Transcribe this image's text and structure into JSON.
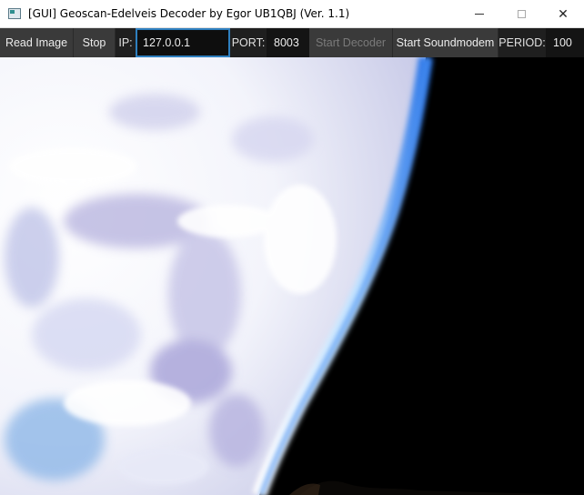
{
  "window": {
    "title": "[GUI] Geoscan-Edelveis Decoder by Egor UB1QBJ (Ver. 1.1)",
    "controls": {
      "close_glyph": "✕"
    }
  },
  "toolbar": {
    "read_image_label": "Read Image",
    "stop_label": "Stop",
    "ip_label": "IP:",
    "ip_value": "127.0.0.1",
    "port_label": "PORT:",
    "port_value": "8003",
    "start_decoder_label": "Start Decoder",
    "start_soundmodem_label": "Start Soundmodem",
    "period_label": "PERIOD:",
    "period_value": "100"
  },
  "icons": [
    "app-icon",
    "minimize-icon",
    "maximize-icon",
    "close-icon"
  ],
  "colors": {
    "toolbar_bg": "#1f1f1f",
    "button_bg": "#3a3a3a",
    "field_bg": "#141414",
    "focus_border": "#2e7fbf",
    "disabled_text": "#7a7a7a",
    "space": "#000000",
    "cloud_white": "#ffffff",
    "cloud_lavender": "#b9b6e0",
    "atmosphere_blue": "#4a90f0"
  }
}
